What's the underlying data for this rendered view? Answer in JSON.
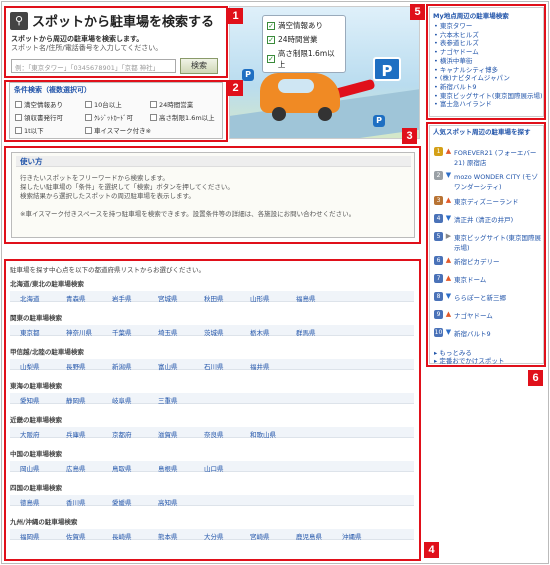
{
  "search": {
    "title": "スポットから駐車場を検索する",
    "desc1": "スポットから周辺の駐車場を検索します。",
    "desc2": "スポット名/住所/電話番号を入力してください。",
    "placeholder": "例：「東京タワー」「0345678901」「京都 神社」",
    "button": "検索"
  },
  "conditions": {
    "header": "条件検索（複数選択可）",
    "items": [
      "満空情報あり",
      "10台以上",
      "24時間営業",
      "領収書発行可",
      "ｸﾚｼﾞｯﾄｶｰﾄﾞ可",
      "高さ制限1.6m以上",
      "1t以下",
      "車イスマーク付き※"
    ]
  },
  "hero": {
    "lines": [
      "満空情報あり",
      "24時間営業",
      "高さ制限1.6m以上"
    ],
    "sign": "P"
  },
  "usage": {
    "title": "使い方",
    "lines": [
      "行きたいスポットをフリーワードから検索します。",
      "探したい駐車場の「条件」を選択して「検索」ボタンを押してください。",
      "検索結果から選択したスポットの周辺駐車場を表示します。",
      "※車イスマーク付きスペースを持つ駐車場を検索できます。設置条件等の詳細は、各施設にお問い合わせください。"
    ]
  },
  "prefectures": {
    "intro": "駐車場を探す中心点を以下の都道府県リストからお選びください。",
    "regions": [
      {
        "name": "北海道/東北の駐車場検索",
        "prefs": [
          "北海道",
          "青森県",
          "岩手県",
          "宮城県",
          "秋田県",
          "山形県",
          "福島県"
        ]
      },
      {
        "name": "関東の駐車場検索",
        "prefs": [
          "東京都",
          "神奈川県",
          "千葉県",
          "埼玉県",
          "茨城県",
          "栃木県",
          "群馬県"
        ]
      },
      {
        "name": "甲信越/北陸の駐車場検索",
        "prefs": [
          "山梨県",
          "長野県",
          "新潟県",
          "富山県",
          "石川県",
          "福井県"
        ]
      },
      {
        "name": "東海の駐車場検索",
        "prefs": [
          "愛知県",
          "静岡県",
          "岐阜県",
          "三重県"
        ]
      },
      {
        "name": "近畿の駐車場検索",
        "prefs": [
          "大阪府",
          "兵庫県",
          "京都府",
          "滋賀県",
          "奈良県",
          "和歌山県"
        ]
      },
      {
        "name": "中国の駐車場検索",
        "prefs": [
          "岡山県",
          "広島県",
          "鳥取県",
          "島根県",
          "山口県"
        ]
      },
      {
        "name": "四国の駐車場検索",
        "prefs": [
          "徳島県",
          "香川県",
          "愛媛県",
          "高知県"
        ]
      },
      {
        "name": "九州/沖縄の駐車場検索",
        "prefs": [
          "福岡県",
          "佐賀県",
          "長崎県",
          "熊本県",
          "大分県",
          "宮崎県",
          "鹿児島県",
          "沖縄県"
        ]
      }
    ]
  },
  "mySpots": {
    "title": "My地点周辺の駐車場検索",
    "items": [
      "東京タワー",
      "六本木ヒルズ",
      "表参道ヒルズ",
      "ナゴヤドーム",
      "横浜中華街",
      "キャナルシティ博多",
      "(株)ナビタイムジャパン",
      "新宿バルト9",
      "東京ビッグサイト(東京国際展示場)",
      "富士急ハイランド"
    ]
  },
  "popular": {
    "title": "人気スポット周辺の駐車場を探す",
    "ranks": [
      {
        "num": "1",
        "trend": "up",
        "name": "FOREVER21 (フォーエバー21) 原宿店"
      },
      {
        "num": "2",
        "trend": "down",
        "name": "mozo WONDER CITY (モゾワンダーシティ)"
      },
      {
        "num": "3",
        "trend": "up",
        "name": "東京ディズニーランド"
      },
      {
        "num": "4",
        "trend": "down",
        "name": "清正井 (清正の井戸)"
      },
      {
        "num": "5",
        "trend": "same",
        "name": "東京ビッグサイト(東京国際展示場)"
      },
      {
        "num": "6",
        "trend": "up",
        "name": "新宿ピカデリー"
      },
      {
        "num": "7",
        "trend": "up",
        "name": "東京ドーム"
      },
      {
        "num": "8",
        "trend": "down",
        "name": "ららぽーと新三郷"
      },
      {
        "num": "9",
        "trend": "up",
        "name": "ナゴヤドーム"
      },
      {
        "num": "10",
        "trend": "down",
        "name": "新宿バルト9"
      }
    ],
    "more": "もっとみる",
    "fixed": "定番おでかけスポット"
  },
  "badges": [
    "1",
    "2",
    "3",
    "4",
    "5",
    "6"
  ]
}
